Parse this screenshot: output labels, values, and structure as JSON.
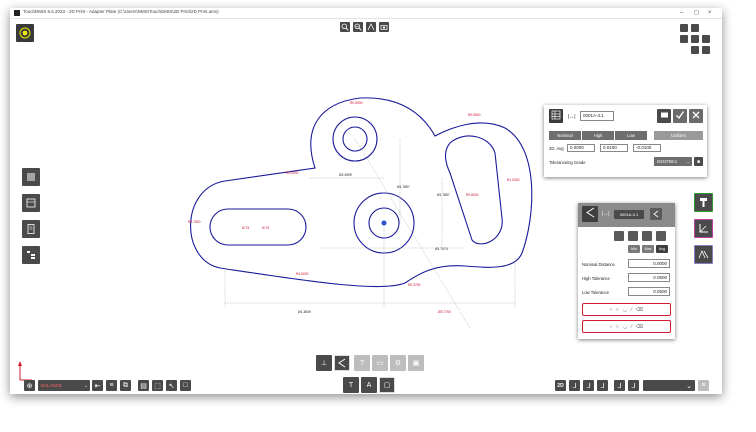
{
  "window": {
    "title": "TouchDMIS 5.6.2023 - 2D Print - Adapter Plate   (C:\\Users\\NMS\\TouchDMIS\\2D Print\\2D Print.ams)",
    "controls": {
      "minimize": "–",
      "maximize": "◻",
      "close": "×"
    }
  },
  "colors": {
    "accent": "#c8102e",
    "toolbar_button": "#4a4a4a",
    "panel_header": "#8b8b8b",
    "measure_icon_border": "#2e9d2e",
    "datum_icon_border": "#c040a0",
    "datum_icon_border_2": "#8a7cc8"
  },
  "top_toolbar": {
    "buttons": [
      {
        "icon": "zoom-in-icon"
      },
      {
        "icon": "zoom-out-icon"
      },
      {
        "icon": "measure-angle-icon"
      },
      {
        "icon": "camera-icon"
      }
    ]
  },
  "target_button": {
    "icon": "target-icon"
  },
  "left_sidebar": {
    "buttons": [
      {
        "icon": "list-view-icon"
      },
      {
        "icon": "feature-table-icon"
      },
      {
        "icon": "report-icon"
      },
      {
        "icon": "tree-view-icon"
      }
    ]
  },
  "drawing": {
    "labels": {
      "slot_left": "Ø.75",
      "slot_right": "Ø.75",
      "dim_horizontal_1": "Ø2.4959",
      "dim_mid_vertical": "Ø1.7887",
      "dim_right_mid": "Ø1.7887",
      "dim_bottom_left": "Ø1.3849",
      "dim_bottom_right": "Ø1.7474",
      "dim_lower": "Ø3.7750",
      "radius_left": "R0.7500",
      "radius_top": "R0.5000",
      "radius_right": "R1.0000",
      "radius_bottom": "R4.5000",
      "radius_top_left": "R2.0000",
      "radius_right_top": "R0.6500",
      "radius_right_upper": "R0.8000",
      "radius_slot": "R0.3750"
    }
  },
  "tolerance_panel": {
    "title_value": "0001A-3.1",
    "tabs": [
      "Nominal",
      "High",
      "Low",
      "Uniform"
    ],
    "row_label": "2D. Avg",
    "values": [
      "0.0000",
      "0.0100",
      "-0.0100"
    ],
    "grade_label": "Toleranceing Grade",
    "grade_value": "ISO2768-1",
    "buttons": {
      "comment_icon": "comment-icon",
      "accept_icon": "check-icon",
      "close_icon": "close-icon",
      "grid_icon": "table-grid-icon"
    }
  },
  "distance_panel": {
    "title_value": "0001A-3.1",
    "fields": [
      {
        "label": "Nominal Distance",
        "value": "0.0000"
      },
      {
        "label": "High Tolerance",
        "value": "0.0500"
      },
      {
        "label": "Low Tolerance",
        "value": "0.0500"
      }
    ],
    "small_buttons": [
      "Min",
      "Max",
      "Avg"
    ],
    "row1_icons": [
      "circle-icon",
      "arc-icon",
      "line-icon",
      "eraser-icon"
    ],
    "row2_icons": [
      "circle-icon",
      "arc-icon",
      "line-icon",
      "eraser-icon"
    ]
  },
  "right_sidebar": {
    "top_grid": [
      "grid-a-icon",
      "grid-b-icon",
      "grid-c-icon",
      "grid-d-icon",
      "grid-e-icon",
      "grid-f-icon",
      "grid-g-icon"
    ],
    "tool_buttons": [
      {
        "icon": "probe-icon"
      },
      {
        "icon": "datum-axis-icon"
      },
      {
        "icon": "datum-distance-icon"
      }
    ]
  },
  "bottom_left": {
    "select_value": "BALANCE",
    "icons": [
      "arrow-left-icon",
      "layers-icon",
      "copy-icon",
      "paste-icon",
      "select-icon",
      "cursor-icon",
      "stop-icon"
    ]
  },
  "bottom_center": {
    "row1": [
      "probe-point-icon",
      "distance-icon",
      "help-icon",
      "folder-icon",
      "settings-icon",
      "screenshot-icon"
    ],
    "row2": [
      "probe-tool-icon",
      "datum-icon",
      "stop-square-icon"
    ]
  },
  "bottom_right": {
    "mode_label": "2D",
    "icons": [
      "axis-xy-icon",
      "axis-yz-icon",
      "axis-zx-icon",
      "axis-3d-icon",
      "axis-x-icon"
    ],
    "select_value": "",
    "end_icon": "menu-icon"
  }
}
